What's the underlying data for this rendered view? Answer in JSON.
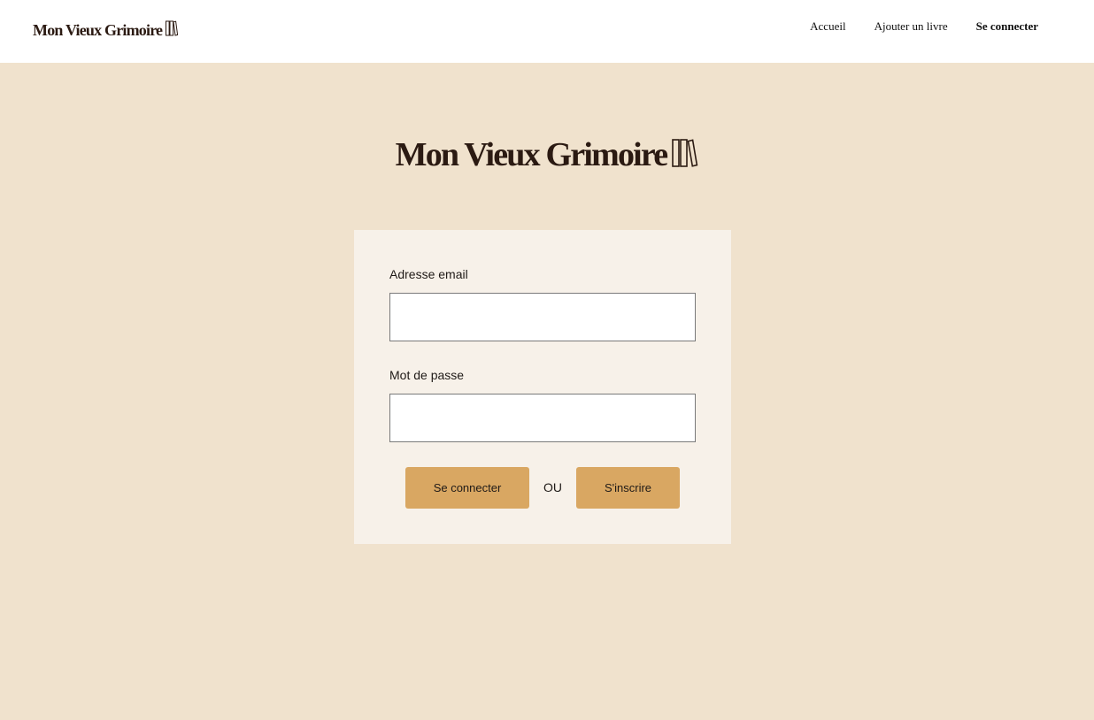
{
  "header": {
    "logo_text": "Mon Vieux Grimoire",
    "logo_icon": "books-icon",
    "nav": [
      {
        "label": "Accueil"
      },
      {
        "label": "Ajouter un livre"
      },
      {
        "label": "Se connecter",
        "active": true
      }
    ]
  },
  "hero": {
    "logo_text": "Mon Vieux Grimoire",
    "logo_icon": "books-icon"
  },
  "login_form": {
    "email_label": "Adresse email",
    "email_value": "",
    "password_label": "Mot de passe",
    "password_value": "",
    "login_button": "Se connecter",
    "separator": "OU",
    "signup_button": "S'inscrire"
  },
  "colors": {
    "page_background": "#f0e2cd",
    "card_background": "#f7f1e9",
    "button": "#d9a762",
    "logo": "#2b1a12"
  }
}
